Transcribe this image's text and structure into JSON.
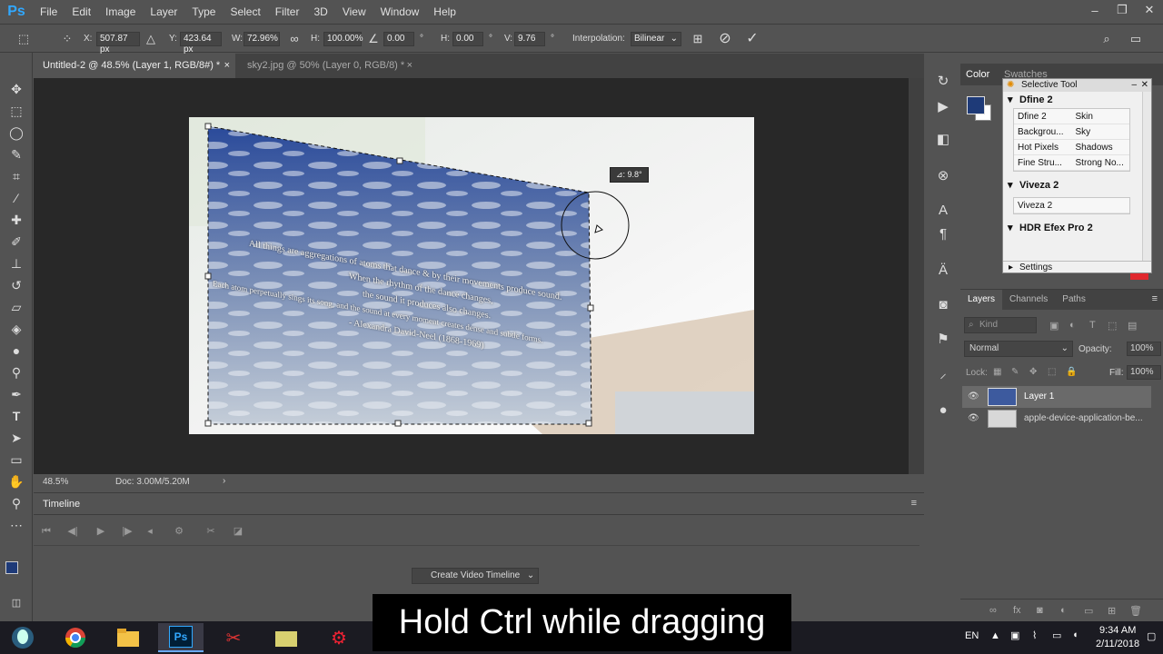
{
  "app": {
    "logo": "Ps"
  },
  "menu": [
    "File",
    "Edit",
    "Image",
    "Layer",
    "Type",
    "Select",
    "Filter",
    "3D",
    "View",
    "Window",
    "Help"
  ],
  "options": {
    "x_label": "X:",
    "x_value": "507.87 px",
    "y_label": "Y:",
    "y_value": "423.64 px",
    "w_label": "W:",
    "w_value": "72.96%",
    "h_label": "H:",
    "h_value": "100.00%",
    "angle_value": "0.00",
    "angle_unit": "°",
    "hskew_label": "H:",
    "hskew_value": "0.00",
    "hskew_unit": "°",
    "vskew_label": "V:",
    "vskew_value": "9.76",
    "vskew_unit": "°",
    "interp_label": "Interpolation:",
    "interp_value": "Bilinear"
  },
  "tabs": [
    {
      "label": "Untitled-2 @ 48.5% (Layer 1, RGB/8#) *",
      "active": true
    },
    {
      "label": "sky2.jpg @ 50% (Layer 0, RGB/8) *",
      "active": false
    }
  ],
  "canvas": {
    "tooltip": "⊿: 9.8°",
    "poem_lines": [
      "All things are aggregations of atoms that dance & by their movements produce sound.",
      "When the rhythm of the dance changes,",
      "the sound it produces also changes.",
      "Each atom perpetually sings its song, and the sound at every moment creates dense and subtle forms.",
      "- Alexandra David-Neel (1868-1969)"
    ]
  },
  "status": {
    "zoom": "48.5%",
    "doc": "Doc: 3.00M/5.20M"
  },
  "timeline": {
    "title": "Timeline",
    "create_button": "Create Video Timeline"
  },
  "color_panel": {
    "tab_color": "Color",
    "tab_swatches": "Swatches",
    "fg": "#1e3a78",
    "bg": "#ffffff"
  },
  "selective_tool": {
    "title": "Selective Tool",
    "sections": [
      {
        "name": "Dfine 2",
        "rows": [
          [
            "Dfine 2",
            "Skin"
          ],
          [
            "Backgrou...",
            "Sky"
          ],
          [
            "Hot Pixels",
            "Shadows"
          ],
          [
            "Fine Stru...",
            "Strong No..."
          ]
        ]
      },
      {
        "name": "Viveza 2",
        "rows": [
          [
            "Viveza 2",
            ""
          ]
        ]
      },
      {
        "name": "HDR Efex Pro 2",
        "rows": []
      }
    ],
    "settings": "Settings"
  },
  "layers_panel": {
    "tabs": [
      "Layers",
      "Channels",
      "Paths"
    ],
    "kind": "Kind",
    "blend_mode": "Normal",
    "opacity_label": "Opacity:",
    "opacity_value": "100%",
    "lock_label": "Lock:",
    "fill_label": "Fill:",
    "fill_value": "100%",
    "layers": [
      {
        "name": "Layer 1",
        "selected": true
      },
      {
        "name": "apple-device-application-be...",
        "selected": false
      }
    ]
  },
  "caption": "Hold Ctrl while dragging",
  "taskbar": {
    "lang": "EN",
    "time": "9:34 AM",
    "date": "2/11/2018"
  }
}
